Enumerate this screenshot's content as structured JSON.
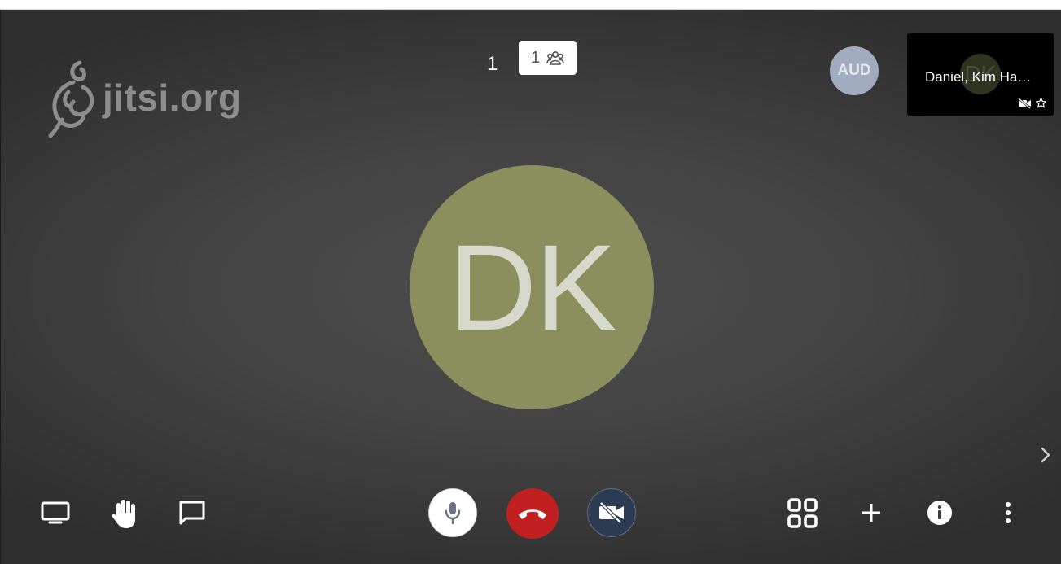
{
  "logo": {
    "text": "jitsi.org",
    "icon": "jitsi-logo-icon"
  },
  "header": {
    "counter": "1",
    "participants_count": "1",
    "participants_icon": "participants-icon"
  },
  "filmstrip": {
    "audio_only_avatar": "AUD",
    "thumbnail": {
      "initials": "DK",
      "name": "Daniel, Kim Ha…",
      "icons": [
        "video-muted-icon",
        "moderator-star-icon"
      ]
    },
    "toggle_icon": "chevron-right-icon"
  },
  "main": {
    "avatar_initials": "DK",
    "avatar_color": "#8a8f5d"
  },
  "toolbar": {
    "left": [
      "screen-share-icon",
      "raise-hand-icon",
      "chat-icon"
    ],
    "center": [
      "microphone-icon",
      "hangup-icon",
      "video-off-icon"
    ],
    "right": [
      "tile-view-icon",
      "invite-plus-icon",
      "info-icon",
      "more-vertical-icon"
    ],
    "colors": {
      "hangup": "#c0201f",
      "video_off": "#2d3b52"
    }
  }
}
